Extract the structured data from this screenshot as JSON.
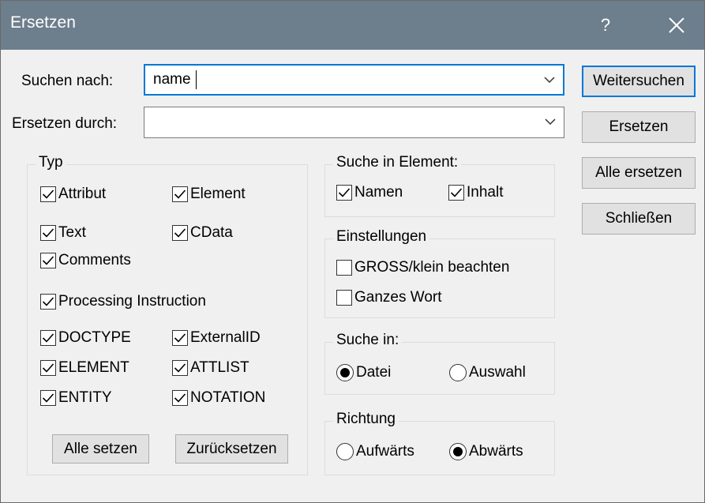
{
  "window": {
    "title": "Ersetzen",
    "help_glyph": "?",
    "help_icon": "question-mark-icon",
    "close_icon": "close-x-icon"
  },
  "search": {
    "label": "Suchen nach:",
    "value": "name"
  },
  "replace": {
    "label": "Ersetzen durch:",
    "value": ""
  },
  "buttons": {
    "find_next": "Weitersuchen",
    "replace": "Ersetzen",
    "replace_all": "Alle ersetzen",
    "close": "Schließen"
  },
  "typ": {
    "title": "Typ",
    "items": [
      {
        "label": "Attribut",
        "checked": true
      },
      {
        "label": "Element",
        "checked": true
      },
      {
        "label": "Text",
        "checked": true
      },
      {
        "label": "CData",
        "checked": true
      },
      {
        "label": "Comments",
        "checked": true
      },
      {
        "label": "Processing Instruction",
        "checked": true
      },
      {
        "label": "DOCTYPE",
        "checked": true
      },
      {
        "label": "ExternalID",
        "checked": true
      },
      {
        "label": "ELEMENT",
        "checked": true
      },
      {
        "label": "ATTLIST",
        "checked": true
      },
      {
        "label": "ENTITY",
        "checked": true
      },
      {
        "label": "NOTATION",
        "checked": true
      }
    ],
    "set_all": "Alle setzen",
    "reset": "Zurücksetzen"
  },
  "search_in_element": {
    "title": "Suche in Element:",
    "names": "Namen",
    "content": "Inhalt",
    "names_checked": true,
    "content_checked": true
  },
  "settings": {
    "title": "Einstellungen",
    "case": "GROSS/klein beachten",
    "whole_word": "Ganzes Wort",
    "case_checked": false,
    "whole_word_checked": false
  },
  "search_in": {
    "title": "Suche in:",
    "file": "Datei",
    "selection": "Auswahl",
    "selected": "file"
  },
  "direction": {
    "title": "Richtung",
    "up": "Aufwärts",
    "down": "Abwärts",
    "selected": "down"
  },
  "colors": {
    "titlebar": "#6d7e8d",
    "accent": "#0078d7",
    "dialog_bg": "#f0f0f0"
  }
}
